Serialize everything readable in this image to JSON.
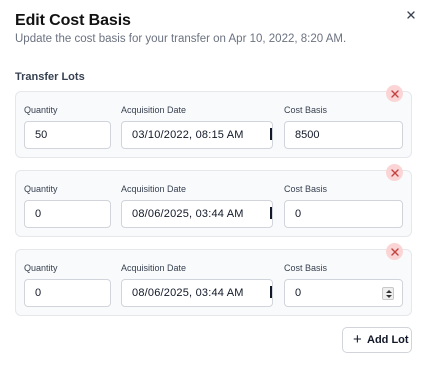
{
  "dialog": {
    "title": "Edit Cost Basis",
    "subtitle": "Update the cost basis for your transfer on Apr 10, 2022, 8:20 AM."
  },
  "section": {
    "label": "Transfer Lots"
  },
  "field_labels": {
    "quantity": "Quantity",
    "acquisition_date": "Acquisition Date",
    "cost_basis": "Cost Basis"
  },
  "lots": [
    {
      "quantity": "50",
      "acquisition_date": "03/10/2022, 08:15 AM",
      "cost_basis": "8500"
    },
    {
      "quantity": "0",
      "acquisition_date": "08/06/2025, 03:44 AM",
      "cost_basis": "0"
    },
    {
      "quantity": "0",
      "acquisition_date": "08/06/2025, 03:44 AM",
      "cost_basis": "0"
    }
  ],
  "add_lot": {
    "icon": "+",
    "label": "Add Lot"
  },
  "icons": {
    "close": "close-icon",
    "remove": "remove-lot-icon",
    "calendar": "calendar-icon",
    "spinner": "number-spinner"
  },
  "colors": {
    "remove_bg": "#fbd5d5",
    "remove_fg": "#c24141",
    "panel_bg": "#f9fafb",
    "border": "#d1d5db"
  }
}
